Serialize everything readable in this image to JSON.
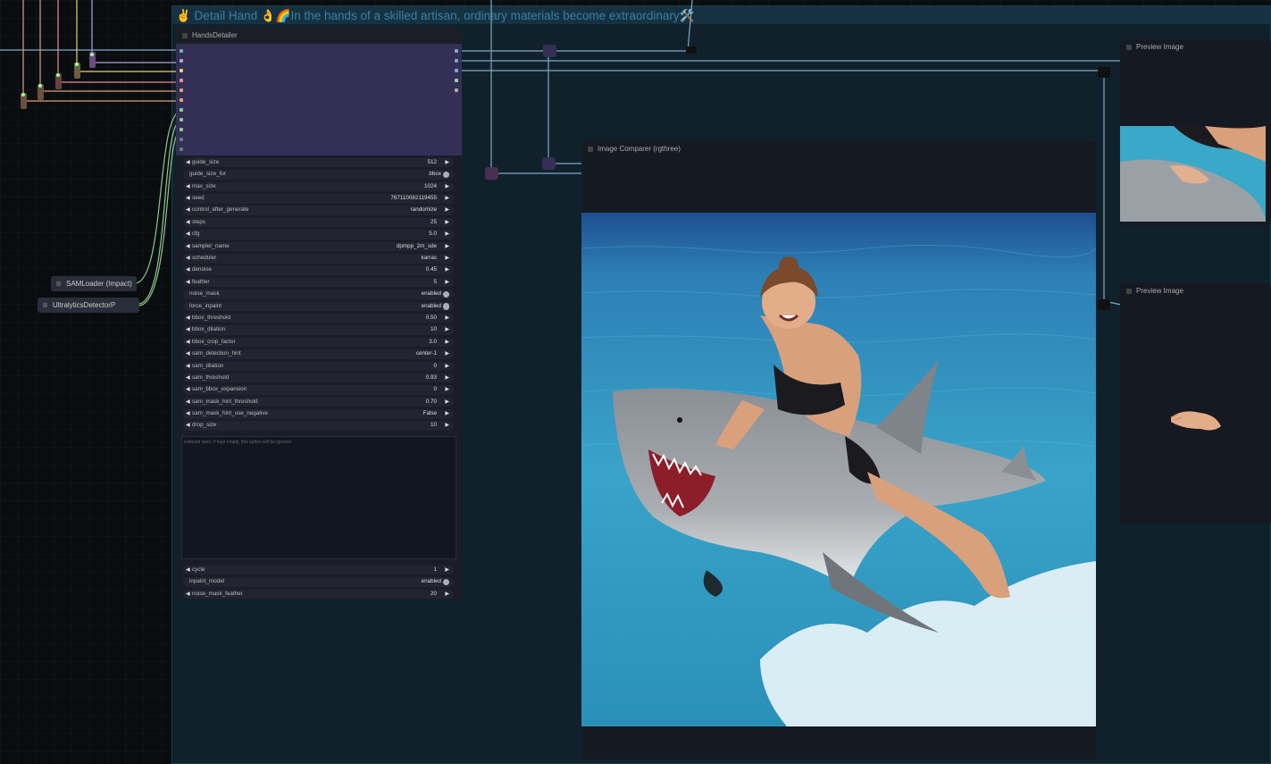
{
  "group": {
    "title": "✌️ Detail Hand 👌🌈In the hands of a skilled artisan, ordinary materials become extraordinary🛠️"
  },
  "hands_detailer": {
    "title": "HandsDetailer",
    "widgets": [
      {
        "label": "guide_size",
        "value": "512",
        "kind": "number"
      },
      {
        "label": "guide_size_for",
        "value": "bbox",
        "kind": "toggle"
      },
      {
        "label": "max_size",
        "value": "1024",
        "kind": "number"
      },
      {
        "label": "seed",
        "value": "767110082119455",
        "kind": "number"
      },
      {
        "label": "control_after_generate",
        "value": "randomize",
        "kind": "number"
      },
      {
        "label": "steps",
        "value": "25",
        "kind": "number"
      },
      {
        "label": "cfg",
        "value": "5.0",
        "kind": "number"
      },
      {
        "label": "sampler_name",
        "value": "dpmpp_2m_sde",
        "kind": "number"
      },
      {
        "label": "scheduler",
        "value": "karras",
        "kind": "number"
      },
      {
        "label": "denoise",
        "value": "0.45",
        "kind": "number"
      },
      {
        "label": "feather",
        "value": "5",
        "kind": "number"
      },
      {
        "label": "noise_mask",
        "value": "enabled",
        "kind": "toggle"
      },
      {
        "label": "force_inpaint",
        "value": "enabled",
        "kind": "toggle"
      },
      {
        "label": "bbox_threshold",
        "value": "0.50",
        "kind": "number"
      },
      {
        "label": "bbox_dilation",
        "value": "10",
        "kind": "number"
      },
      {
        "label": "bbox_crop_factor",
        "value": "3.0",
        "kind": "number"
      },
      {
        "label": "sam_detection_hint",
        "value": "center-1",
        "kind": "number"
      },
      {
        "label": "sam_dilation",
        "value": "0",
        "kind": "number"
      },
      {
        "label": "sam_threshold",
        "value": "0.93",
        "kind": "number"
      },
      {
        "label": "sam_bbox_expansion",
        "value": "0",
        "kind": "number"
      },
      {
        "label": "sam_mask_hint_threshold",
        "value": "0.70",
        "kind": "number"
      },
      {
        "label": "sam_mask_hint_use_negative",
        "value": "False",
        "kind": "number"
      },
      {
        "label": "drop_size",
        "value": "10",
        "kind": "number"
      }
    ],
    "wildcard_placeholder": "wildcard spec: if kept empty, this option will be ignored",
    "widgets_after": [
      {
        "label": "cycle",
        "value": "1",
        "kind": "number"
      },
      {
        "label": "inpaint_model",
        "value": "enabled",
        "kind": "toggle"
      },
      {
        "label": "noise_mask_feather",
        "value": "20",
        "kind": "number"
      }
    ]
  },
  "sam_loader": {
    "title": "SAMLoader (Impact)"
  },
  "ultralytics": {
    "title": "UltralyticsDetectorP"
  },
  "image_comparer": {
    "title": "Image Comparer (rgthree)"
  },
  "preview_1": {
    "title": "Preview Image"
  },
  "preview_2": {
    "title": "Preview Image"
  },
  "colors": {
    "group_bg": "#10212b",
    "node_io": "#332f55",
    "wire_blue": "#7fa8c8",
    "wire_green": "#8fc78f"
  }
}
